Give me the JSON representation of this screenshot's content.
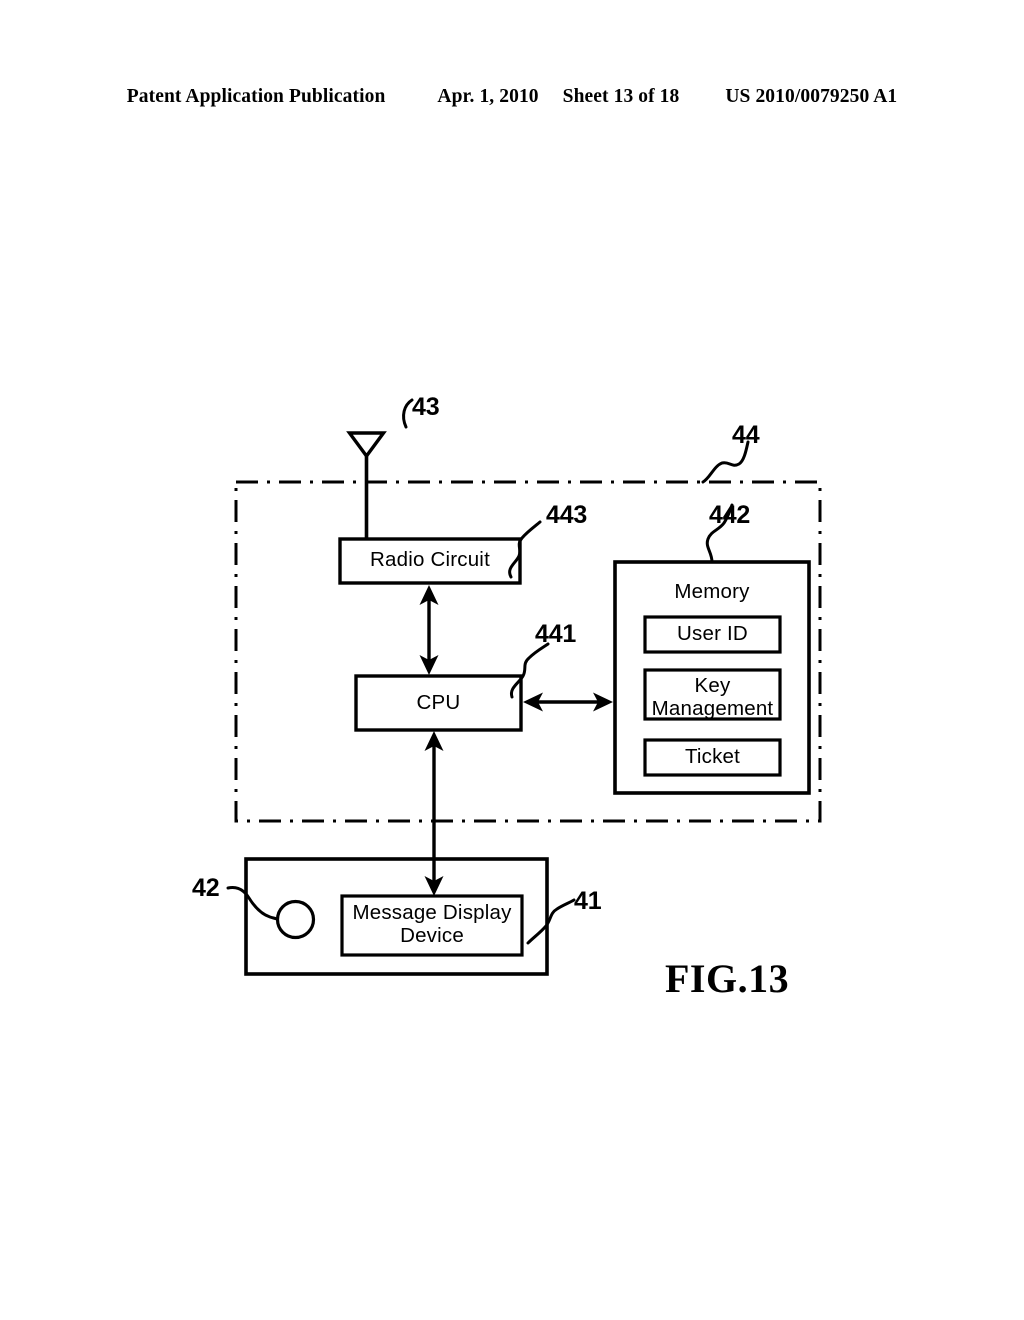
{
  "page_header": {
    "publication": "Patent Application Publication",
    "date": "Apr. 1, 2010",
    "sheet": "Sheet 13 of 18",
    "patent_number": "US 2010/0079250 A1"
  },
  "figure": {
    "caption": "FIG.13",
    "blocks": {
      "radio_circuit": "Radio Circuit",
      "cpu": "CPU",
      "memory": "Memory",
      "user_id": "User ID",
      "key_management_line1": "Key",
      "key_management_line2": "Management",
      "ticket": "Ticket",
      "message_display_line1": "Message Display",
      "message_display_line2": "Device"
    },
    "reference_numerals": {
      "antenna": "43",
      "terminal_unit": "44",
      "radio_circuit": "443",
      "memory": "442",
      "cpu": "441",
      "display_housing": "41",
      "indicator": "42"
    }
  }
}
